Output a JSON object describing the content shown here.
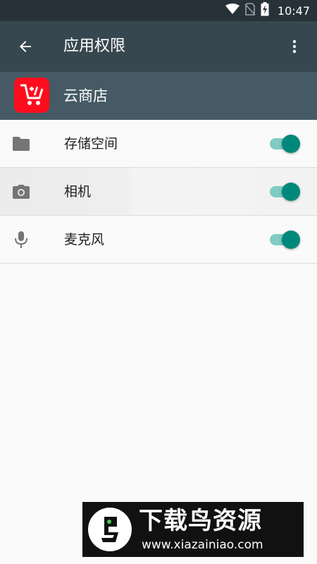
{
  "status_bar": {
    "time": "10:47"
  },
  "toolbar": {
    "title": "应用权限"
  },
  "app": {
    "name": "云商店"
  },
  "permissions": [
    {
      "label": "存储空间",
      "icon": "folder-icon",
      "enabled": true
    },
    {
      "label": "相机",
      "icon": "camera-icon",
      "enabled": true
    },
    {
      "label": "麦克风",
      "icon": "microphone-icon",
      "enabled": true
    }
  ],
  "watermark": {
    "title": "下载鸟资源",
    "url": "www.xiazainiao.com"
  },
  "colors": {
    "toolbar": "#37474f",
    "appbar": "#455a64",
    "accent": "#00897b",
    "app_icon": "#ff0d1d"
  }
}
